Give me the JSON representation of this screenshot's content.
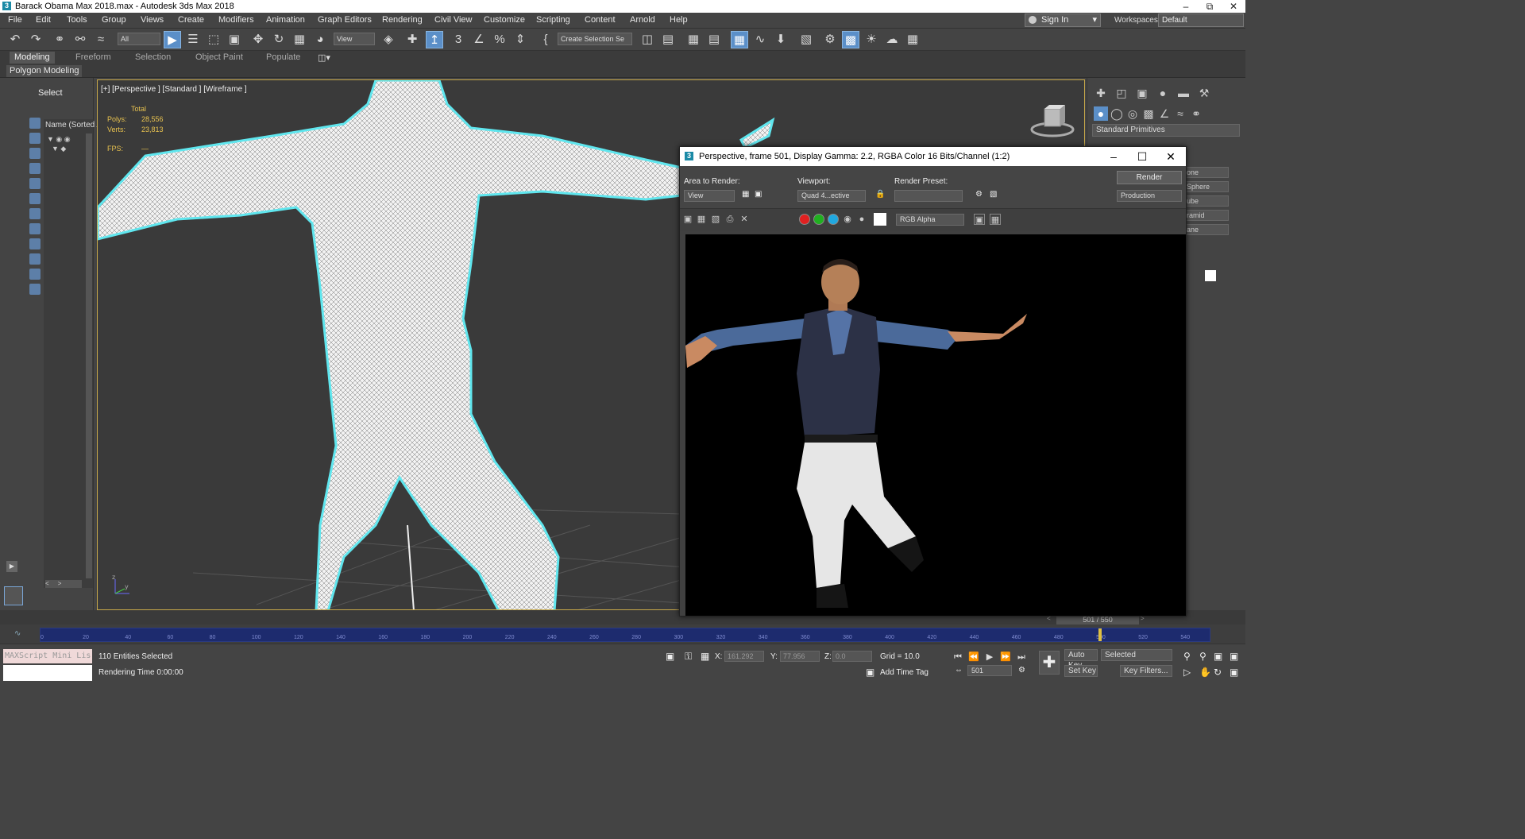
{
  "window": {
    "title": "Barack Obama Max 2018.max - Autodesk 3ds Max 2018",
    "app_icon_glyph": "3"
  },
  "menu": [
    "File",
    "Edit",
    "Tools",
    "Group",
    "Views",
    "Create",
    "Modifiers",
    "Animation",
    "Graph Editors",
    "Rendering",
    "Civil View",
    "Customize",
    "Scripting",
    "Content",
    "Arnold",
    "Help"
  ],
  "account": {
    "signin_label": "Sign In"
  },
  "workspaces": {
    "label": "Workspaces:",
    "value": "Default"
  },
  "toolbar": {
    "filter_select": "All",
    "view_select": "View",
    "selection_set": "Create Selection Se"
  },
  "ribbon": {
    "tabs": [
      "Modeling",
      "Freeform",
      "Selection",
      "Object Paint",
      "Populate"
    ],
    "active_tab": "Modeling",
    "sub": "Polygon Modeling"
  },
  "scene_explorer": {
    "select_label": "Select",
    "column_header": "Name (Sorted A"
  },
  "viewport": {
    "label": "[+] [Perspective ] [Standard ] [Wireframe ]",
    "stats_header": "Total",
    "polys_label": "Polys:",
    "polys_value": "28,556",
    "verts_label": "Verts:",
    "verts_value": "23,813",
    "fps_label": "FPS:",
    "fps_value": "—",
    "axis_z": "z",
    "axis_y": "y"
  },
  "command_panel": {
    "category": "Standard Primitives",
    "buttons": [
      "one",
      "Sphere",
      "ube",
      "ramid",
      "ane"
    ]
  },
  "frame_window": {
    "title": "Perspective, frame 501, Display Gamma: 2.2, RGBA Color 16 Bits/Channel (1:2)",
    "area_label": "Area to Render:",
    "area_value": "View",
    "viewport_label": "Viewport:",
    "viewport_value": "Quad 4...ective",
    "preset_label": "Render Preset:",
    "preset_value": "",
    "render_button": "Render",
    "render_mode": "Production",
    "channel": "RGB Alpha"
  },
  "timeline": {
    "slider_label": "501 / 550",
    "current_frame": 501,
    "total_frames": 550,
    "ticks": [
      "0",
      "20",
      "40",
      "60",
      "80",
      "100",
      "120",
      "140",
      "160",
      "180",
      "200",
      "220",
      "240",
      "260",
      "280",
      "300",
      "320",
      "340",
      "360",
      "380",
      "400",
      "420",
      "440",
      "460",
      "480",
      "500",
      "520",
      "540"
    ]
  },
  "status": {
    "maxscript": "MAXScript Mini Lis",
    "selected_text": "110 Entities Selected",
    "rendering_time": "Rendering Time 0:00:00",
    "x_label": "X:",
    "x_value": "161.292",
    "y_label": "Y:",
    "y_value": "77.956",
    "z_label": "Z:",
    "z_value": "0.0",
    "grid": "Grid = 10.0",
    "add_time_tag": "Add Time Tag",
    "frame": "501",
    "auto_key": "Auto Key",
    "selected_mode": "Selected",
    "set_key": "Set Key",
    "key_filters": "Key Filters..."
  },
  "colors": {
    "viewport_border": "#c7a84a",
    "selection_outline": "#5fe6ee",
    "stats_text": "#e8c24f",
    "active_tool": "#5b8fc8",
    "timeline_track": "#1d2b6e"
  }
}
